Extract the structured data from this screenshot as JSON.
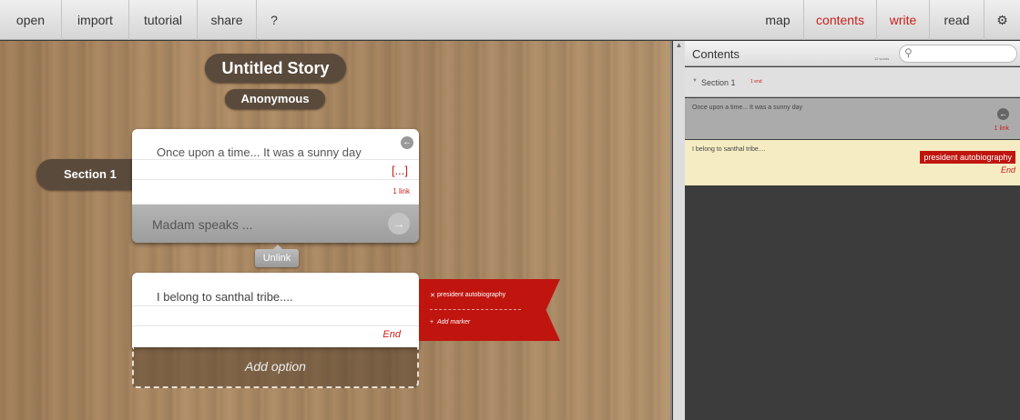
{
  "toolbar": {
    "open": "open",
    "import": "import",
    "tutorial": "tutorial",
    "share": "share",
    "help": "?",
    "map": "map",
    "contents": "contents",
    "write": "write",
    "read": "read",
    "settings_icon": "gear-icon"
  },
  "story": {
    "title": "Untitled Story",
    "author": "Anonymous",
    "section_label": "Section 1",
    "passage1": {
      "text": "Once upon a time... It was a sunny day",
      "bracket": "[...]",
      "link": "1 link"
    },
    "option1": {
      "text": "Madam speaks ..."
    },
    "unlink_label": "Unlink",
    "passage2": {
      "text": "I belong to santhal tribe....",
      "end": "End"
    },
    "marker": {
      "name": "president autobiography",
      "add": "Add marker"
    },
    "add_option": "Add option"
  },
  "panel": {
    "title": "Contents",
    "search_placeholder": "",
    "word_count": "12 words",
    "section": {
      "label": "Section 1",
      "count": "1 end"
    },
    "row1": {
      "text": "Once upon a time... It was a sunny day",
      "link": "1 link"
    },
    "row2": {
      "text": "I belong to santhal tribe....",
      "marker": "president autobiography",
      "end": "End"
    }
  },
  "colors": {
    "accent": "#c8201a",
    "marker": "#c0150f",
    "highlight": "#f5ecc3"
  }
}
